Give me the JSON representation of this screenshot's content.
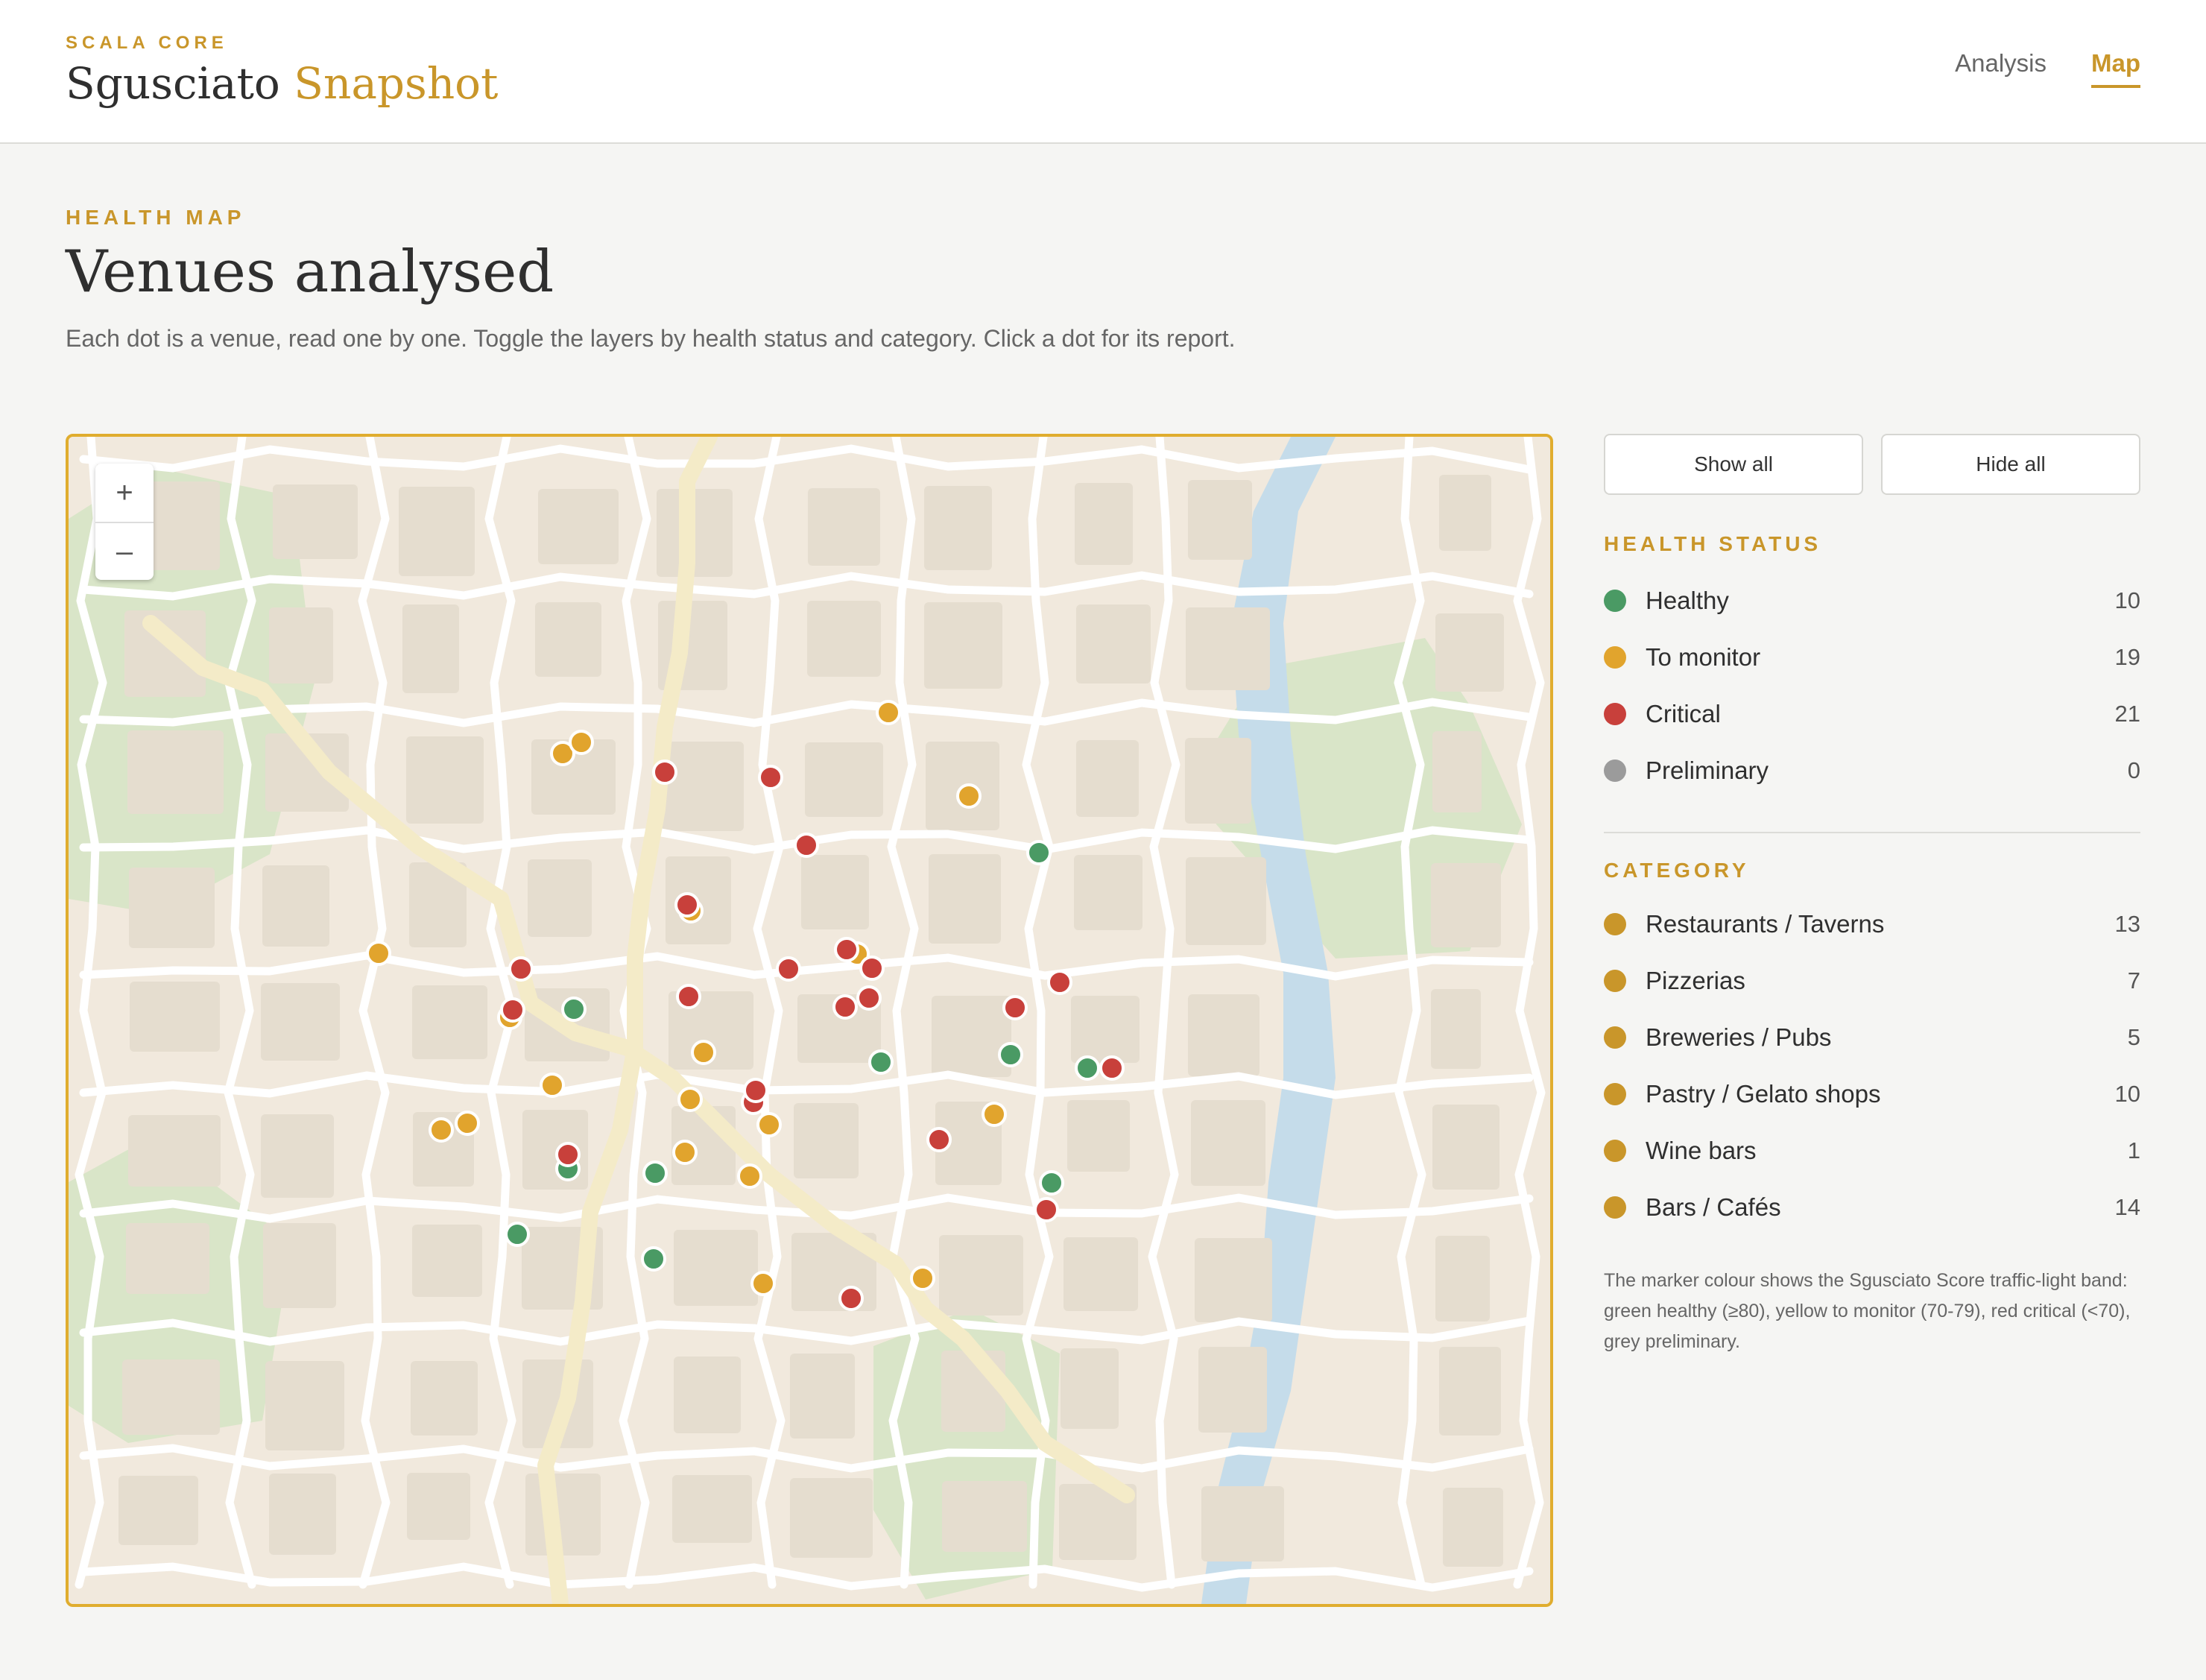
{
  "header": {
    "eyebrow": "SCALA CORE",
    "title_main": "Sgusciato",
    "title_accent": "Snapshot",
    "nav": [
      {
        "label": "Analysis",
        "active": false
      },
      {
        "label": "Map",
        "active": true
      }
    ]
  },
  "intro": {
    "eyebrow": "HEALTH MAP",
    "title": "Venues analysed",
    "description": "Each dot is a venue, read one by one. Toggle the layers by health status and category. Click a dot for its report."
  },
  "map": {
    "zoom_in_symbol": "+",
    "zoom_out_symbol": "–",
    "marker_colors": {
      "healthy": "#4a9a64",
      "monitor": "#e1a42d",
      "critical": "#c8403b",
      "preliminary": "#9b9b9b"
    }
  },
  "controls": {
    "show_all": "Show all",
    "hide_all": "Hide all"
  },
  "health_status": {
    "title": "HEALTH STATUS",
    "items": [
      {
        "label": "Healthy",
        "count": "10",
        "color": "#4a9a64"
      },
      {
        "label": "To monitor",
        "count": "19",
        "color": "#e1a42d"
      },
      {
        "label": "Critical",
        "count": "21",
        "color": "#c8403b"
      },
      {
        "label": "Preliminary",
        "count": "0",
        "color": "#9b9b9b"
      }
    ]
  },
  "category": {
    "title": "CATEGORY",
    "items": [
      {
        "label": "Restaurants / Taverns",
        "count": "13",
        "color": "#c9962a"
      },
      {
        "label": "Pizzerias",
        "count": "7",
        "color": "#c9962a"
      },
      {
        "label": "Breweries / Pubs",
        "count": "5",
        "color": "#c9962a"
      },
      {
        "label": "Pastry / Gelato shops",
        "count": "10",
        "color": "#c9962a"
      },
      {
        "label": "Wine bars",
        "count": "1",
        "color": "#c9962a"
      },
      {
        "label": "Bars / Cafés",
        "count": "14",
        "color": "#c9962a"
      }
    ]
  },
  "note": "The marker colour shows the Sgusciato Score traffic-light band: green healthy (≥80), yellow to monitor (70-79), red critical (<70), grey preliminary."
}
